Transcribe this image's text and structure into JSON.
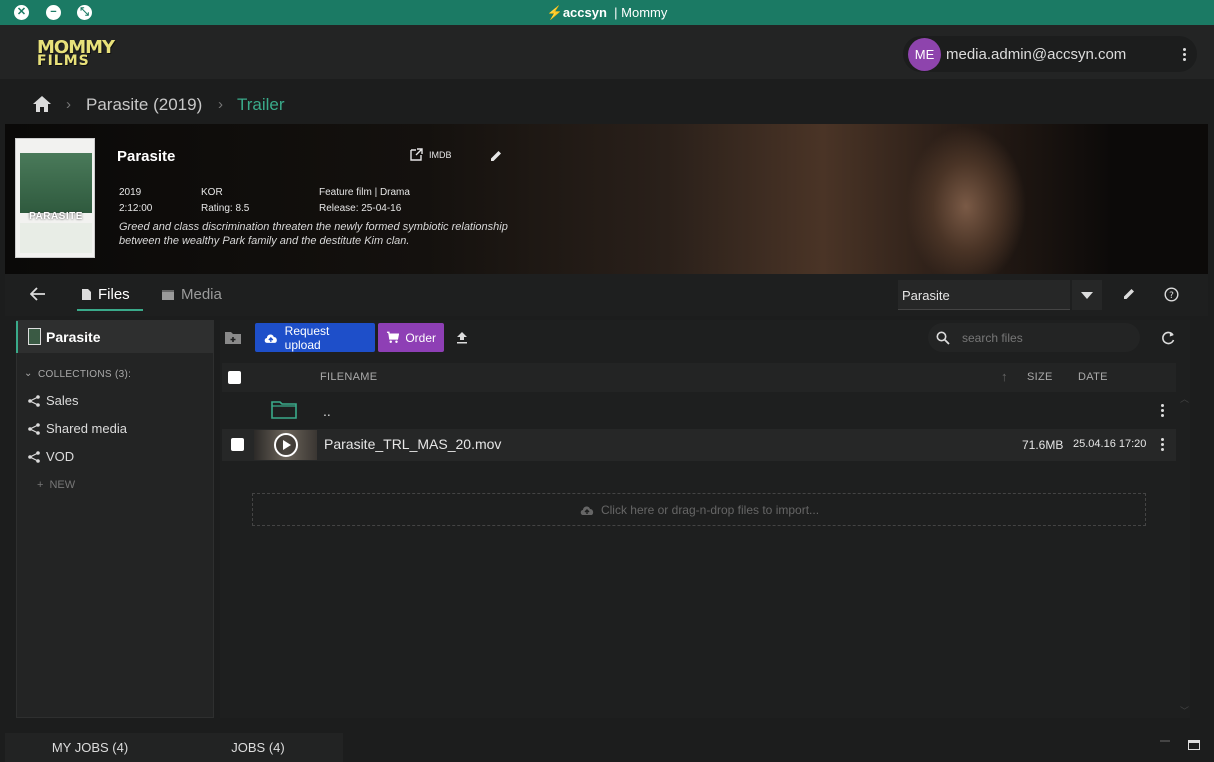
{
  "titlebar": {
    "brand": "accsyn",
    "window_title": "| Mommy"
  },
  "header": {
    "logo_line1": "MOMMY",
    "logo_line2": "FILMS",
    "user": {
      "initials": "ME",
      "email": "media.admin@accsyn.com"
    }
  },
  "breadcrumb": {
    "items": [
      "Parasite (2019)",
      "Trailer"
    ]
  },
  "movie": {
    "title": "Parasite",
    "poster_title": "PARASITE",
    "imdb_label": "IMDB",
    "year": "2019",
    "country": "KOR",
    "genre": "Feature film | Drama",
    "duration": "2:12:00",
    "rating": "Rating: 8.5",
    "release": "Release: 25-04-16",
    "synopsis": "Greed and class discrimination threaten the newly formed symbiotic relationship between the wealthy Park family and the destitute Kim clan."
  },
  "tabs": {
    "files": "Files",
    "media": "Media"
  },
  "collection_select": {
    "value": "Parasite"
  },
  "sidebar": {
    "root": "Parasite",
    "collections_header": "COLLECTIONS (3):",
    "collections": [
      "Sales",
      "Shared media",
      "VOD"
    ],
    "new_label": "NEW"
  },
  "toolbar": {
    "request_upload": "Request upload",
    "order": "Order",
    "search_placeholder": "search files"
  },
  "table": {
    "columns": {
      "filename": "FILENAME",
      "size": "SIZE",
      "date": "DATE"
    },
    "parent_dir": "..",
    "rows": [
      {
        "filename": "Parasite_TRL_MAS_20.mov",
        "size": "71.6MB",
        "date": "25.04.16 17:20"
      }
    ]
  },
  "drop_zone": {
    "text": "Click here or drag-n-drop files to import..."
  },
  "bottom": {
    "my_jobs": "MY JOBS (4)",
    "jobs": "JOBS (4)"
  },
  "colors": {
    "accent": "#3aaa8a",
    "titlebar": "#1b7a64",
    "request_upload": "#1e4fc9",
    "order": "#8e3fb5",
    "avatar": "#8e44ad"
  }
}
